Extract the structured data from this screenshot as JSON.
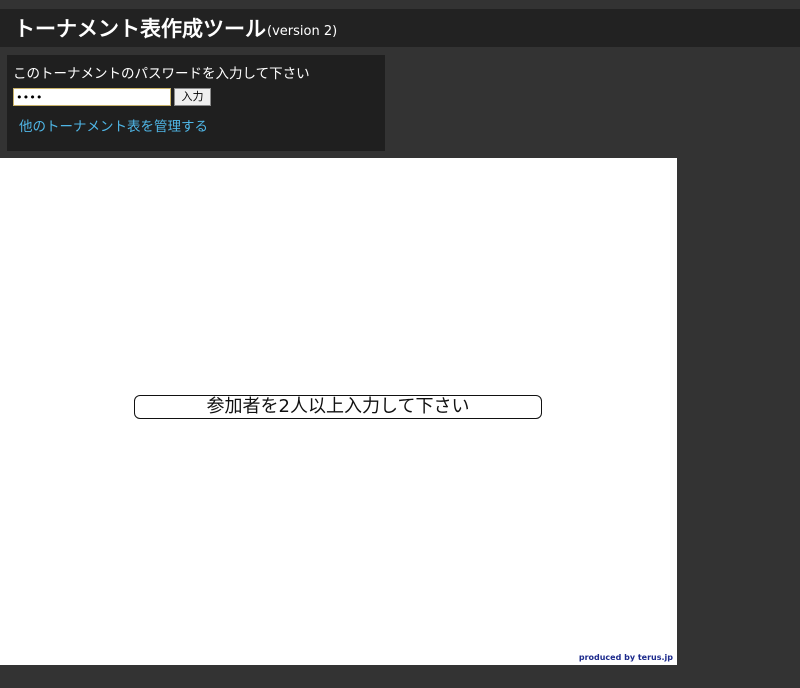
{
  "header": {
    "title": "トーナメント表作成ツール",
    "version": "(version 2)"
  },
  "login": {
    "prompt": "このトーナメントのパスワードを入力して下さい",
    "password_value": "••••",
    "enter_label": "入力",
    "manage_link": "他のトーナメント表を管理する"
  },
  "canvas": {
    "message": "参加者を2人以上入力して下さい",
    "credit": "produced by terus.jp"
  },
  "colors": {
    "background": "#333333",
    "header_bar": "#222222",
    "panel": "#1f1f1f",
    "link": "#4fb6e6",
    "credit": "#1c2a8c"
  }
}
